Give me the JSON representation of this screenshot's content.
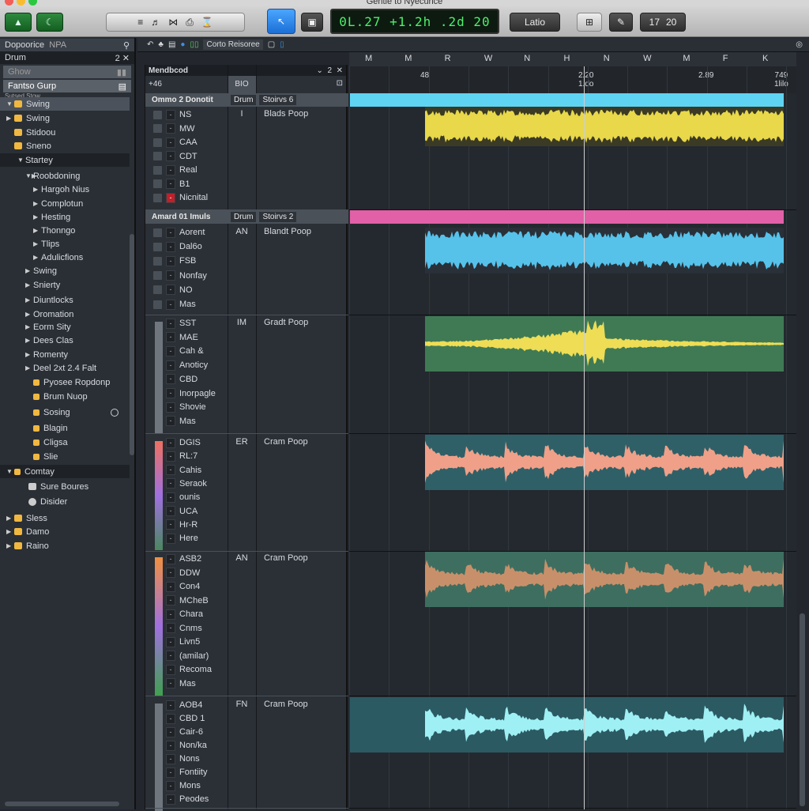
{
  "window": {
    "title": "Gentle to Nyecurice"
  },
  "toolbar": {
    "btn1": "▲",
    "btn2": "☾",
    "tool_icons": [
      "≡",
      "♬",
      "⋈",
      "⎙",
      "⌛"
    ],
    "lcd": "0L.27  +1.2h .2d  20",
    "mode": "Latio",
    "counter_a": "17",
    "counter_b": "20"
  },
  "sidebar": {
    "search_label": "Dopoorice",
    "search_value": "NPA",
    "section": "Drum",
    "section_count": "2",
    "filter": "Ghow",
    "group": "Fantso Gurp",
    "subhead": "Sutsed Stow",
    "items": [
      {
        "label": "Swing",
        "arrow": "▼",
        "icon": "folder",
        "indent": 8,
        "sel": true
      },
      {
        "label": "Swing",
        "arrow": "▶",
        "icon": "folder",
        "indent": 8
      },
      {
        "label": "Stidoou",
        "arrow": "",
        "icon": "folder",
        "indent": 8
      },
      {
        "label": "Sneno",
        "arrow": "",
        "icon": "folder",
        "indent": 8
      },
      {
        "label": "Startey",
        "arrow": "▼",
        "icon": "",
        "indent": 22,
        "sep": true
      },
      {
        "label": "Roobdoning",
        "arrow": "▼▶",
        "icon": "",
        "indent": 32
      },
      {
        "label": "Hargoh Nius",
        "arrow": "▶",
        "icon": "",
        "indent": 42
      },
      {
        "label": "Complotun",
        "arrow": "▶",
        "icon": "",
        "indent": 42
      },
      {
        "label": "Hesting",
        "arrow": "▶",
        "icon": "",
        "indent": 42
      },
      {
        "label": "Thonngo",
        "arrow": "▶",
        "icon": "",
        "indent": 42
      },
      {
        "label": "Tlips",
        "arrow": "▶",
        "icon": "",
        "indent": 42
      },
      {
        "label": "Adulicfions",
        "arrow": "▶",
        "icon": "",
        "indent": 42
      },
      {
        "label": "Swing",
        "arrow": "▶",
        "icon": "",
        "indent": 32
      },
      {
        "label": "Snierty",
        "arrow": "▶",
        "icon": "",
        "indent": 32
      },
      {
        "label": "Diuntlocks",
        "arrow": "▶",
        "icon": "",
        "indent": 32
      },
      {
        "label": "Oromation",
        "arrow": "▶",
        "icon": "",
        "indent": 32
      },
      {
        "label": "Eorm Sity",
        "arrow": "▶",
        "icon": "",
        "indent": 32
      },
      {
        "label": "Dees Clas",
        "arrow": "▶",
        "icon": "",
        "indent": 32
      },
      {
        "label": "Romenty",
        "arrow": "▶",
        "icon": "",
        "indent": 32
      },
      {
        "label": "Deel 2xt 2.4 Falt",
        "arrow": "▶",
        "icon": "",
        "indent": 32
      },
      {
        "label": "Pyosee Ropdonp",
        "arrow": "",
        "icon": "square",
        "indent": 32
      },
      {
        "label": "Brum Nuop",
        "arrow": "",
        "icon": "square",
        "indent": 32
      },
      {
        "label": "Sosing",
        "arrow": "",
        "icon": "square",
        "indent": 32,
        "badge": "!"
      },
      {
        "label": "Blagin",
        "arrow": "",
        "icon": "square",
        "indent": 32
      },
      {
        "label": "Cligsa",
        "arrow": "",
        "icon": "square",
        "indent": 32
      },
      {
        "label": "Slie",
        "arrow": "",
        "icon": "square",
        "indent": 32
      },
      {
        "label": "Comtay",
        "arrow": "▼",
        "icon": "square",
        "indent": 8,
        "sep": true
      },
      {
        "label": "Sure Boures",
        "arrow": "",
        "icon": "drive",
        "indent": 26
      },
      {
        "label": "Disider",
        "arrow": "",
        "icon": "disc",
        "indent": 26
      },
      {
        "label": "Sless",
        "arrow": "▶",
        "icon": "folder",
        "indent": 8
      },
      {
        "label": "Damo",
        "arrow": "▶",
        "icon": "folder",
        "indent": 8
      },
      {
        "label": "Raino",
        "arrow": "▶",
        "icon": "folder",
        "indent": 8
      }
    ]
  },
  "transport": {
    "label": "Corto Reisoree"
  },
  "track_panel": {
    "title": "Mendbcod",
    "count": "2",
    "tempo": "+46",
    "column": "BIO"
  },
  "ruler": {
    "letters": [
      "M",
      "M",
      "R",
      "W",
      "N",
      "H",
      "N",
      "W",
      "M",
      "F",
      "K"
    ],
    "marks": [
      {
        "value": "48",
        "sub": ""
      },
      {
        "value": "2.20",
        "sub": "1.do"
      },
      {
        "value": "2.89",
        "sub": ""
      },
      {
        "value": "749",
        "sub": "1lilo"
      }
    ]
  },
  "colors": {
    "accent": "#3d8fe0",
    "playhead": "#c8c8c8"
  },
  "tracks": [
    {
      "header": "Ommo  2 Donotit",
      "tag1": "Drum",
      "tag2": "Stoirvs 6",
      "code": "I",
      "name": "Blads Poop",
      "rows": [
        "NS",
        "MW",
        "CAA",
        "CDT",
        "Real",
        "B1",
        "Nicnital"
      ],
      "bar": "#5fd4f2",
      "clip_bg": "#3b3a24",
      "wave": "#e8d84a"
    },
    {
      "header": "Amard  01 Imuls",
      "tag1": "Drum",
      "tag2": "Stoirvs 2",
      "code": "AN",
      "name": "Blandt Poop",
      "rows": [
        "Aorent",
        "Dal6o",
        "FSB",
        "Nonfay",
        "NO",
        "Mas"
      ],
      "bar": "#e160a8",
      "clip_bg": "#2a3038",
      "wave": "#56c2ea"
    },
    {
      "header": "",
      "code": "IM",
      "name": "Gradt Poop",
      "rows": [
        "SST",
        "MAE",
        "Cah &",
        "Anoticy",
        "CBD",
        "Inorpagle",
        "Shovie",
        "Mas"
      ],
      "clip_bg": "#3f7a55",
      "wave": "#eedd55"
    },
    {
      "header": "",
      "code": "ER",
      "name": "Cram Poop",
      "rows": [
        "DGIS",
        "RL:7",
        "Cahis",
        "Seraok",
        "ounis",
        "UCA",
        "Hr-R",
        "Here"
      ],
      "clip_bg": "#2f6068",
      "wave": "#f0a088"
    },
    {
      "header": "",
      "code": "AN",
      "name": "Cram Poop",
      "rows": [
        "ASB2",
        "DDW",
        "Con4",
        "MCheB",
        "Chara",
        "Cnms",
        "Livn5",
        "(amilar)",
        "Recoma",
        "Mas"
      ],
      "clip_bg": "#3e6e60",
      "wave": "#c8906a"
    },
    {
      "header": "",
      "code": "FN",
      "name": "Cram Poop",
      "rows": [
        "AOB4",
        "CBD 1",
        "Cair-6",
        "Non/ka",
        "Nons",
        "Fontiity",
        "Mons",
        "Peodes"
      ],
      "clip_bg": "#2c5a62",
      "wave": "#9ef0f4"
    }
  ]
}
